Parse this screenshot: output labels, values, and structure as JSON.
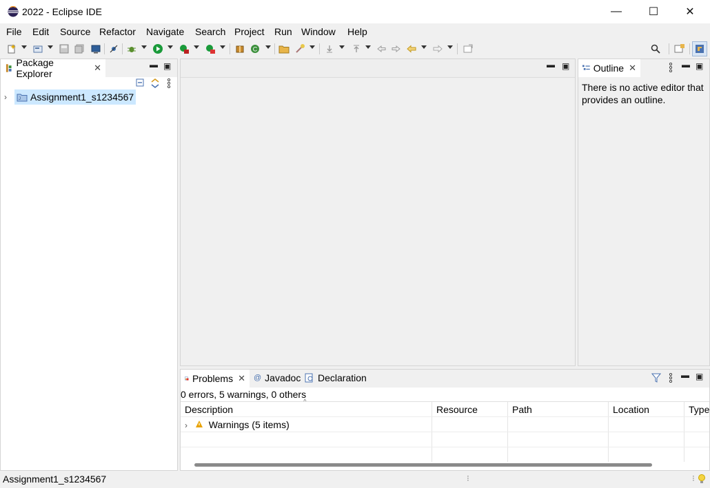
{
  "window": {
    "title": "2022 - Eclipse IDE",
    "minimize_glyph": "—",
    "maximize_glyph": "☐",
    "close_glyph": "✕"
  },
  "menu": {
    "items": [
      "File",
      "Edit",
      "Source",
      "Refactor",
      "Navigate",
      "Search",
      "Project",
      "Run",
      "Window",
      "Help"
    ]
  },
  "package_explorer": {
    "tab_label": "Package Explorer",
    "project_name": "Assignment1_s1234567"
  },
  "outline": {
    "tab_label": "Outline",
    "message_line1": "There is no active editor that",
    "message_line2": "provides an outline."
  },
  "bottom_panel": {
    "tabs": [
      "Problems",
      "Javadoc",
      "Declaration"
    ],
    "summary": "0 errors, 5 warnings, 0 others",
    "columns": [
      "Description",
      "Resource",
      "Path",
      "Location",
      "Type"
    ],
    "rows": [
      {
        "description": "Warnings (5 items)",
        "resource": "",
        "path": "",
        "location": "",
        "type": ""
      }
    ]
  },
  "status": {
    "text": "Assignment1_s1234567"
  },
  "colors": {
    "accent": "#cce8ff",
    "warning": "#e8a200",
    "run_green": "#1a9a3a",
    "eclipse_purple": "#2c2255"
  }
}
